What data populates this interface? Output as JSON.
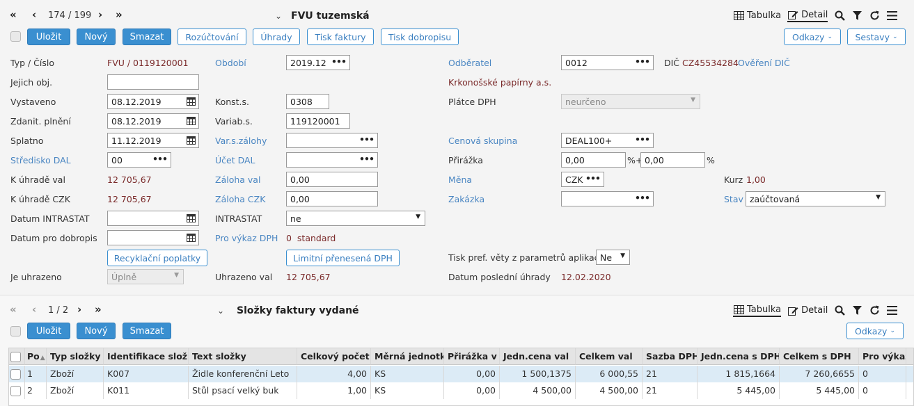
{
  "header": {
    "counter": "174 / 199",
    "title": "FVU tuzemská",
    "view_table": "Tabulka",
    "view_detail": "Detail"
  },
  "toolbar": {
    "save": "Uložit",
    "new": "Nový",
    "delete": "Smazat",
    "rozuctovani": "Rozúčtování",
    "uhrady": "Úhrady",
    "tisk_faktury": "Tisk faktury",
    "tisk_dobropisu": "Tisk dobropisu",
    "odkazy": "Odkazy",
    "sestavy": "Sestavy"
  },
  "form": {
    "typ_cislo_label": "Typ / Číslo",
    "typ_cislo_value": "FVU / 0119120001",
    "obdobi_label": "Období",
    "obdobi_value": "2019.12",
    "odberatel_label": "Odběratel",
    "odberatel_value": "0012",
    "dic_label": "DIČ",
    "dic_value": "CZ45534284",
    "overeni_dic": "Ověření DIČ",
    "jejich_obj_label": "Jejich obj.",
    "jejich_obj_value": "",
    "company_name": "Krkonošské papírny a.s.",
    "vystaveno_label": "Vystaveno",
    "vystaveno_value": "08.12.2019",
    "konst_label": "Konst.s.",
    "konst_value": "0308",
    "platce_dph_label": "Plátce DPH",
    "platce_dph_value": "neurčeno",
    "zdanit_label": "Zdanit. plnění",
    "zdanit_value": "08.12.2019",
    "variab_label": "Variab.s.",
    "variab_value": "119120001",
    "splatno_label": "Splatno",
    "splatno_value": "11.12.2019",
    "var_zalohy_label": "Var.s.zálohy",
    "var_zalohy_value": "",
    "cenova_skupina_label": "Cenová skupina",
    "cenova_skupina_value": "DEAL100+",
    "stredisko_label": "Středisko DAL",
    "stredisko_value": "00",
    "ucet_dal_label": "Účet DAL",
    "ucet_dal_value": "",
    "prirazka_label": "Přirážka",
    "prirazka_value1": "0,00",
    "prirazka_sep": "%+",
    "prirazka_value2": "0,00",
    "prirazka_unit": "%",
    "k_uhrade_val_label": "K úhradě val",
    "k_uhrade_val_value": "12 705,67",
    "zaloha_val_label": "Záloha val",
    "zaloha_val_value": "0,00",
    "mena_label": "Měna",
    "mena_value": "CZK",
    "kurz_label": "Kurz",
    "kurz_value": "1,00",
    "k_uhrade_czk_label": "K úhradě CZK",
    "k_uhrade_czk_value": "12 705,67",
    "zaloha_czk_label": "Záloha CZK",
    "zaloha_czk_value": "0,00",
    "zakazka_label": "Zakázka",
    "zakazka_value": "",
    "stav_label": "Stav",
    "stav_value": "zaúčtovaná",
    "datum_intrastat_label": "Datum INTRASTAT",
    "datum_intrastat_value": "",
    "intrastat_label": "INTRASTAT",
    "intrastat_value": "ne",
    "datum_dobropis_label": "Datum pro dobropis",
    "datum_dobropis_value": "",
    "pro_vykaz_label": "Pro výkaz DPH",
    "pro_vykaz_value": "0  standard",
    "recyklacni_button": "Recyklační poplatky",
    "limitni_button": "Limitní přenesená DPH",
    "tisk_pref_label": "Tisk pref. věty z parametrů aplikace",
    "tisk_pref_value": "Ne",
    "je_uhrazeno_label": "Je uhrazeno",
    "je_uhrazeno_value": "Úplně",
    "uhrazeno_val_label": "Uhrazeno val",
    "uhrazeno_val_value": "12 705,67",
    "datum_posledni_label": "Datum poslední úhrady",
    "datum_posledni_value": "12.02.2020"
  },
  "sub": {
    "counter": "1 / 2",
    "title": "Složky faktury vydané",
    "view_table": "Tabulka",
    "view_detail": "Detail",
    "save": "Uložit",
    "new": "Nový",
    "delete": "Smazat",
    "odkazy": "Odkazy"
  },
  "grid": {
    "columns": [
      "Po",
      "Typ složky",
      "Identifikace složky",
      "Text složky",
      "Celkový počet",
      "Měrná jednotka",
      "Přirážka v %",
      "Jedn.cena val",
      "Celkem val",
      "Sazba DPH",
      "Jedn.cena s DPH",
      "Celkem s DPH",
      "Pro výkaz"
    ],
    "rows": [
      [
        "1",
        "Zboží",
        "K007",
        "Židle konferenční Leto",
        "4,00",
        "KS",
        "0,00",
        "1 500,1375",
        "6 000,55",
        "21",
        "1 815,1664",
        "7 260,6655",
        "0"
      ],
      [
        "2",
        "Zboží",
        "K011",
        "Stůl psací velký buk",
        "1,00",
        "KS",
        "0,00",
        "4 500,00",
        "4 500,00",
        "21",
        "5 445,00",
        "5 445,00",
        "0"
      ]
    ]
  },
  "colors": {
    "primary": "#3a8fd0",
    "link": "#4a86c2",
    "value_red": "#7a2a2a",
    "row_selected": "#dcebf6"
  }
}
